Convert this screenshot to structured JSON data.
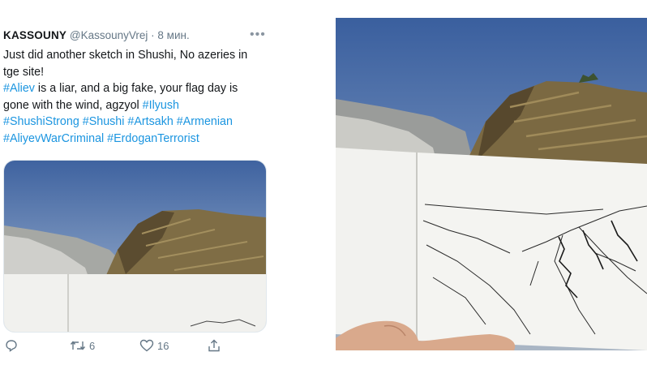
{
  "tweet": {
    "author_name": "KASSOUNY",
    "author_handle": "@KassounyVrej",
    "separator": "·",
    "time": "8 мин.",
    "more_icon": "more-dots-icon",
    "text_lines": [
      [
        {
          "t": "Just did another sketch in Shushi, No azeries in",
          "tag": false
        }
      ],
      [
        {
          "t": "tge site!",
          "tag": false
        }
      ],
      [
        {
          "t": "#Aliev",
          "tag": true
        },
        {
          "t": " is a liar, and a big fake, your flag day is",
          "tag": false
        }
      ],
      [
        {
          "t": "gone with the wind, agzyol ",
          "tag": false
        },
        {
          "t": "#Ilyush",
          "tag": true
        }
      ],
      [
        {
          "t": "#ShushiStrong #Shushi #Artsakh #Armenian",
          "tag": true
        }
      ],
      [
        {
          "t": "#AliyevWarCriminal #ErdoganTerrorist",
          "tag": true
        }
      ]
    ],
    "actions": {
      "reply": {
        "icon": "reply-icon",
        "count": ""
      },
      "retweet": {
        "icon": "retweet-icon",
        "count": "6"
      },
      "like": {
        "icon": "heart-icon",
        "count": "16"
      },
      "share": {
        "icon": "share-icon",
        "count": ""
      }
    }
  },
  "colors": {
    "link": "#1b95e0",
    "text": "#14171a",
    "muted": "#657786",
    "sky": "#4f74a8",
    "hill": "#8a7a52",
    "paper": "#f1f1ee"
  }
}
